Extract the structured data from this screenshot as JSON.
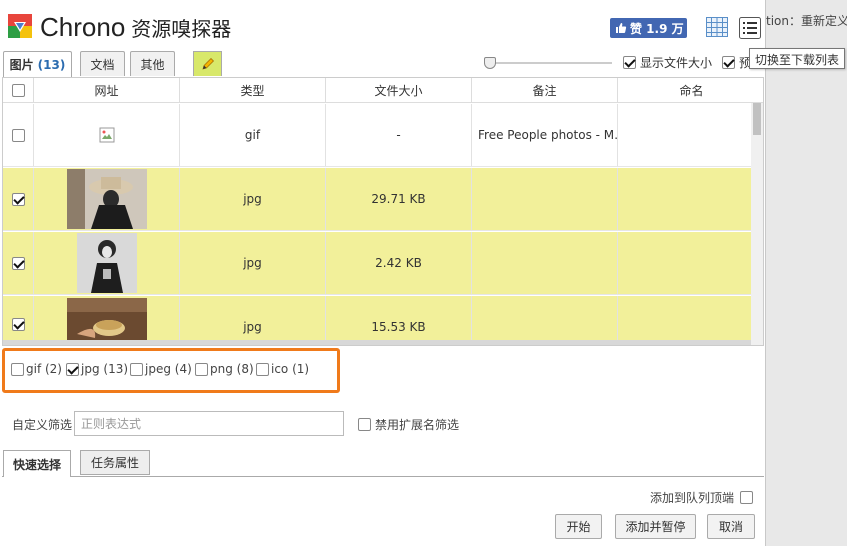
{
  "background": {
    "partial_text": "tion：重新定义"
  },
  "tooltip": "切换至下载列表",
  "header": {
    "title": "Chrono",
    "subtitle": "资源嗅探器",
    "like_label": "赞 1.9 万"
  },
  "tabs": [
    {
      "label": "图片",
      "count": "(13)"
    },
    {
      "label": "文档"
    },
    {
      "label": "其他"
    }
  ],
  "options": {
    "show_file_size": "显示文件大小",
    "preview": "预"
  },
  "table": {
    "columns": [
      "网址",
      "类型",
      "文件大小",
      "备注",
      "命名"
    ],
    "rows": [
      {
        "type": "gif",
        "size": "-",
        "note": "Free People photos - M…",
        "checked": false
      },
      {
        "type": "jpg",
        "size": "29.71 KB",
        "note": "",
        "checked": true
      },
      {
        "type": "jpg",
        "size": "2.42 KB",
        "note": "",
        "checked": true
      },
      {
        "type": "jpg",
        "size": "15.53 KB",
        "note": "",
        "checked": true
      }
    ]
  },
  "filters": [
    {
      "label": "gif (2)",
      "checked": false
    },
    {
      "label": "jpg (13)",
      "checked": true
    },
    {
      "label": "jpeg (4)",
      "checked": false
    },
    {
      "label": "png (8)",
      "checked": false
    },
    {
      "label": "ico (1)",
      "checked": false
    }
  ],
  "custom_filter": {
    "label": "自定义筛选",
    "placeholder": "正则表达式",
    "ext_filter_label": "禁用扩展名筛选"
  },
  "bottom_tabs": [
    "快速选择",
    "任务属性"
  ],
  "queue_label": "添加到队列顶端",
  "buttons": {
    "start": "开始",
    "add_pause": "添加并暂停",
    "cancel": "取消"
  },
  "colors": {
    "selected_row": "#f2f09a",
    "highlight_border": "#f07a1a",
    "like_button": "#4267b2"
  }
}
